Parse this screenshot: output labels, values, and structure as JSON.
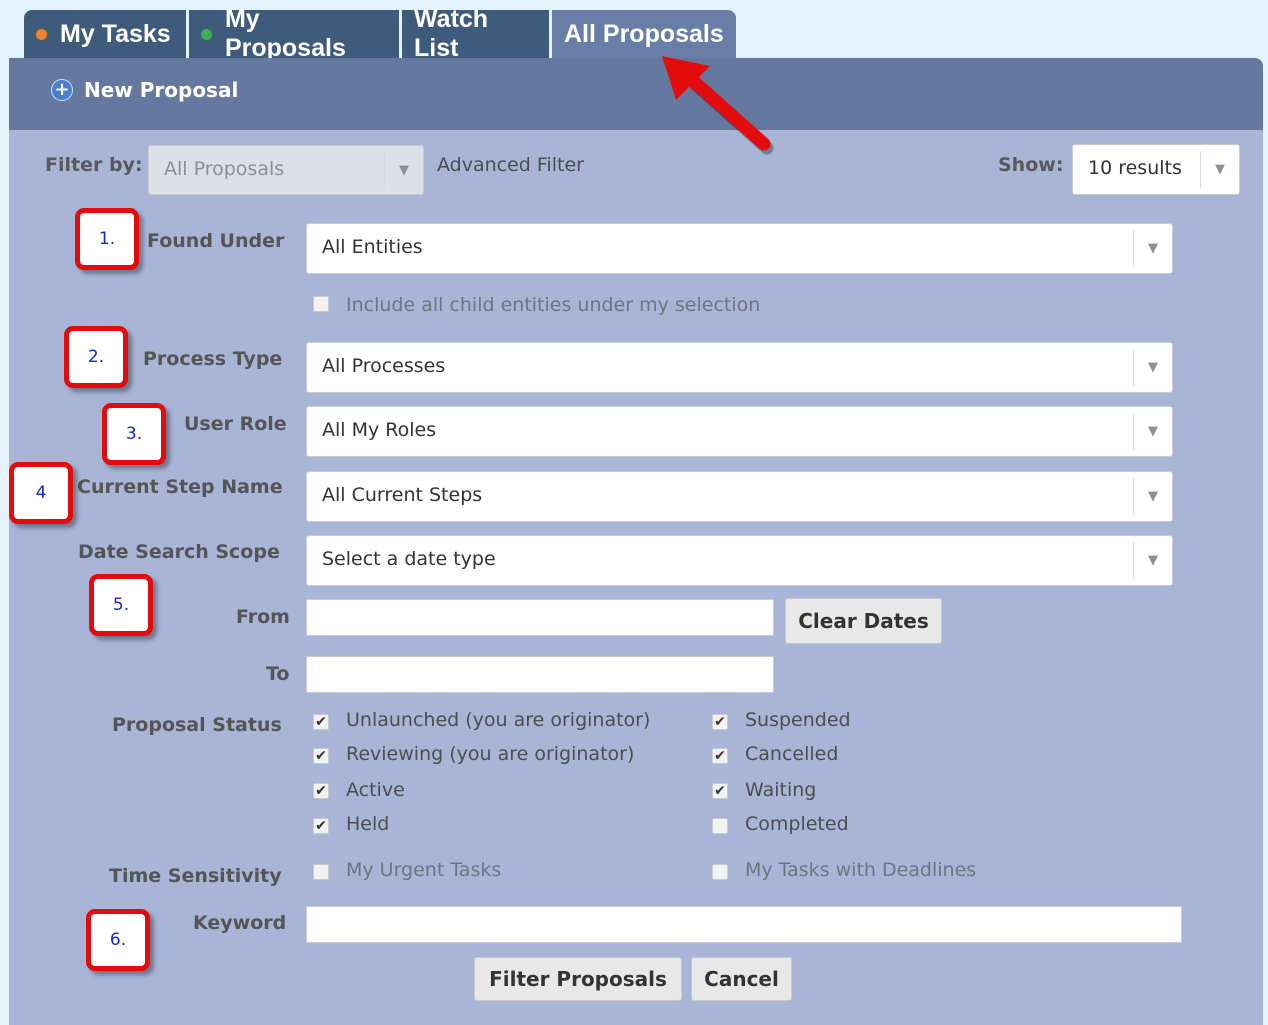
{
  "tabs": [
    {
      "label": "My Tasks",
      "dot_color": "#f0822a"
    },
    {
      "label": "My Proposals",
      "dot_color": "#3fae55"
    },
    {
      "label": "Watch List"
    },
    {
      "label": "All Proposals"
    }
  ],
  "toolbar": {
    "new_proposal": "New Proposal"
  },
  "filter": {
    "filter_by_label": "Filter by:",
    "filter_by_value": "All Proposals",
    "advanced_filter": "Advanced Filter",
    "show_label": "Show:",
    "show_value": "10 results"
  },
  "fields": {
    "found_under": {
      "label": "Found Under",
      "value": "All Entities"
    },
    "include_children": {
      "label": "Include all child entities under my selection",
      "checked": false
    },
    "process_type": {
      "label": "Process Type",
      "value": "All Processes"
    },
    "user_role": {
      "label": "User Role",
      "value": "All My Roles"
    },
    "current_step": {
      "label": "Current Step Name",
      "value": "All Current Steps"
    },
    "date_scope": {
      "label": "Date Search Scope",
      "value": "Select a date type"
    },
    "from": {
      "label": "From",
      "value": ""
    },
    "to": {
      "label": "To",
      "value": ""
    },
    "clear_dates": "Clear Dates",
    "proposal_status": {
      "label": "Proposal Status",
      "options": [
        {
          "label": "Unlaunched (you are originator)",
          "checked": true
        },
        {
          "label": "Suspended",
          "checked": true
        },
        {
          "label": "Reviewing (you are originator)",
          "checked": true
        },
        {
          "label": "Cancelled",
          "checked": true
        },
        {
          "label": "Active",
          "checked": true
        },
        {
          "label": "Waiting",
          "checked": true
        },
        {
          "label": "Held",
          "checked": true
        },
        {
          "label": "Completed",
          "checked": false
        }
      ]
    },
    "time_sensitivity": {
      "label": "Time Sensitivity",
      "options": [
        {
          "label": "My Urgent Tasks",
          "checked": false
        },
        {
          "label": "My Tasks with Deadlines",
          "checked": false
        }
      ]
    },
    "keyword": {
      "label": "Keyword",
      "value": ""
    }
  },
  "buttons": {
    "filter": "Filter Proposals",
    "cancel": "Cancel"
  },
  "annotations": [
    "1.",
    "2.",
    "3.",
    "4",
    "5.",
    "6."
  ],
  "colors": {
    "annotation_border": "#e30b0b",
    "annotation_text": "#1526c9",
    "panel": "#a8b5d7",
    "active_tab": "#697ea7"
  },
  "icons": {
    "checked": "✔",
    "dropdown": "▼"
  }
}
